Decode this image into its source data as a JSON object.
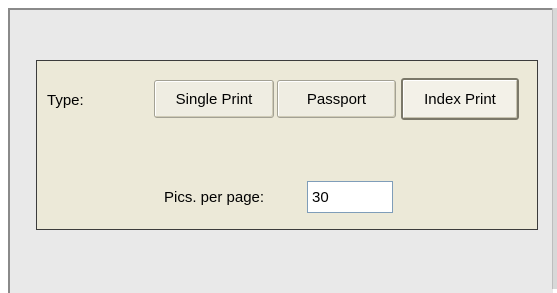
{
  "type_section": {
    "label": "Type:",
    "buttons": [
      {
        "label": "Single Print",
        "selected": false
      },
      {
        "label": "Passport",
        "selected": false
      },
      {
        "label": "Index Print",
        "selected": true
      }
    ]
  },
  "pics_per_page": {
    "label": "Pics. per page:",
    "value": "30"
  }
}
